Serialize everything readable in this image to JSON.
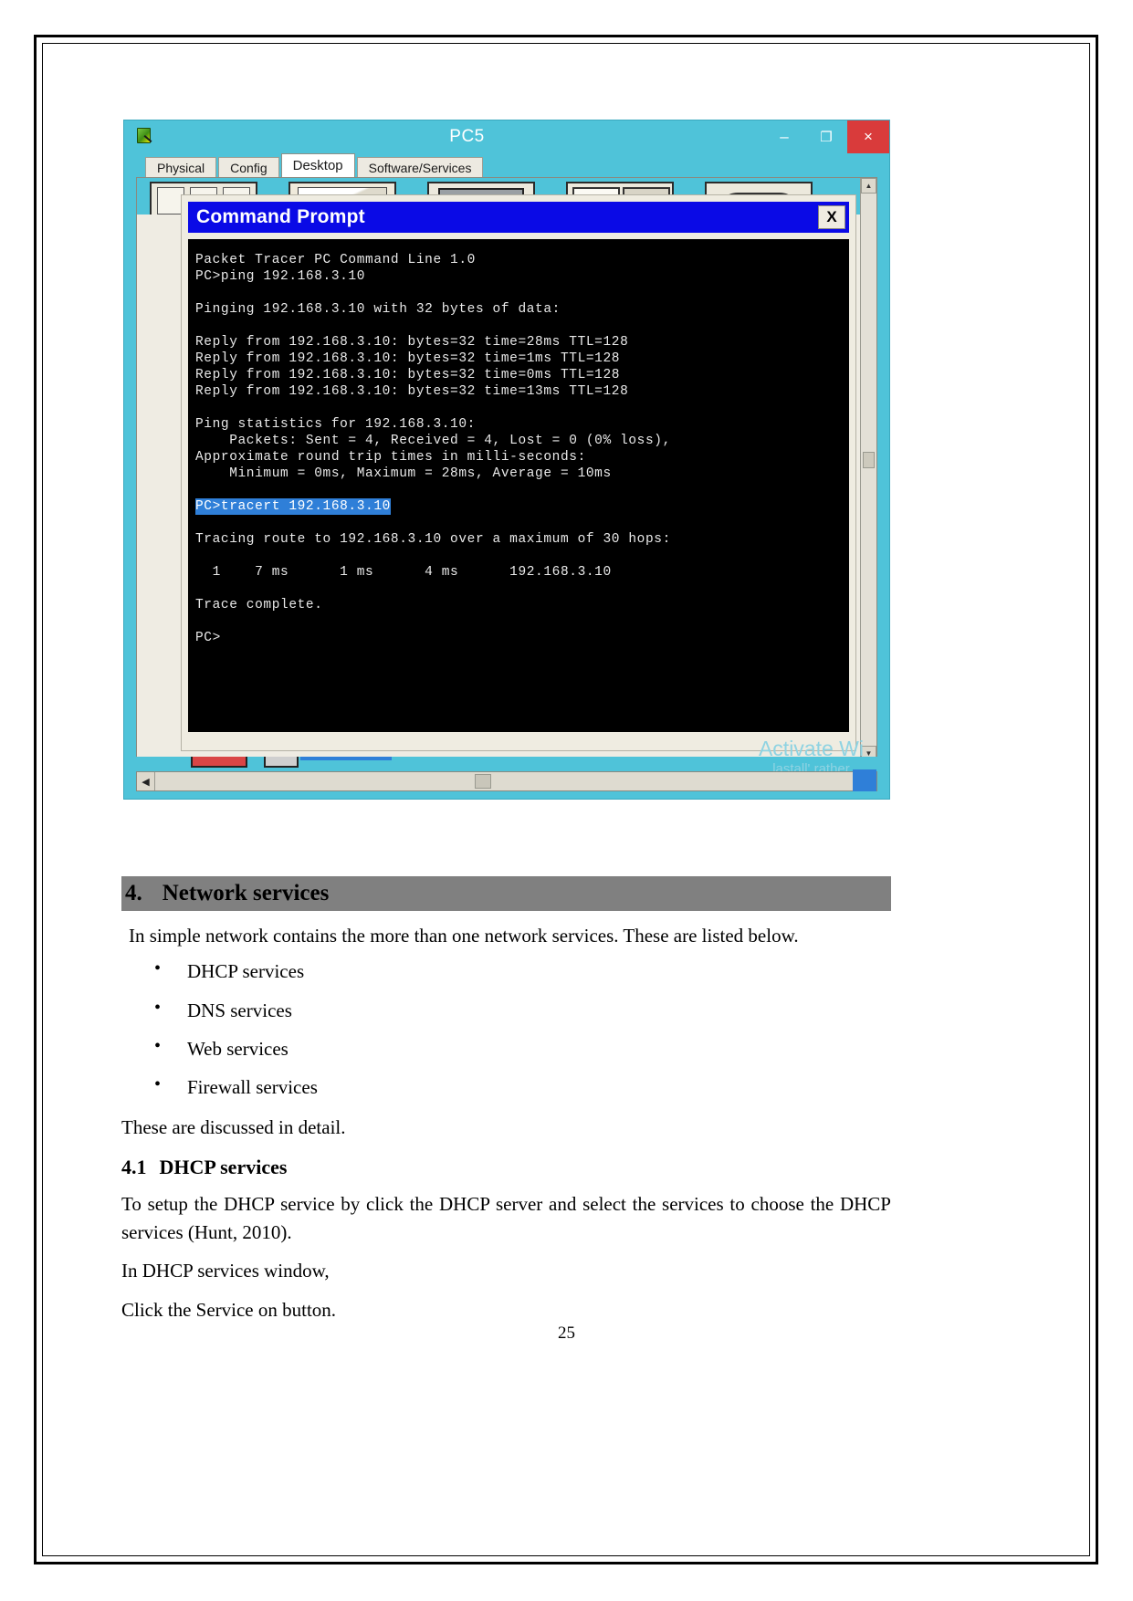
{
  "window": {
    "title": "PC5",
    "icon": "packet-tracer-icon",
    "controls": {
      "minimize": "–",
      "maximize": "❐",
      "close": "×"
    },
    "tabs": [
      {
        "label": "Physical",
        "active": false
      },
      {
        "label": "Config",
        "active": false
      },
      {
        "label": "Desktop",
        "active": true
      },
      {
        "label": "Software/Services",
        "active": false
      }
    ]
  },
  "command_prompt": {
    "title": "Command Prompt",
    "close_label": "X",
    "lines": [
      {
        "text": "Packet Tracer PC Command Line 1.0",
        "selected": false
      },
      {
        "text": "PC>ping 192.168.3.10",
        "selected": false
      },
      {
        "text": "",
        "selected": false
      },
      {
        "text": "Pinging 192.168.3.10 with 32 bytes of data:",
        "selected": false
      },
      {
        "text": "",
        "selected": false
      },
      {
        "text": "Reply from 192.168.3.10: bytes=32 time=28ms TTL=128",
        "selected": false
      },
      {
        "text": "Reply from 192.168.3.10: bytes=32 time=1ms TTL=128",
        "selected": false
      },
      {
        "text": "Reply from 192.168.3.10: bytes=32 time=0ms TTL=128",
        "selected": false
      },
      {
        "text": "Reply from 192.168.3.10: bytes=32 time=13ms TTL=128",
        "selected": false
      },
      {
        "text": "",
        "selected": false
      },
      {
        "text": "Ping statistics for 192.168.3.10:",
        "selected": false
      },
      {
        "text": "    Packets: Sent = 4, Received = 4, Lost = 0 (0% loss),",
        "selected": false
      },
      {
        "text": "Approximate round trip times in milli-seconds:",
        "selected": false
      },
      {
        "text": "    Minimum = 0ms, Maximum = 28ms, Average = 10ms",
        "selected": false
      },
      {
        "text": "",
        "selected": false
      },
      {
        "text": "PC>tracert 192.168.3.10",
        "selected": true
      },
      {
        "text": "",
        "selected": false
      },
      {
        "text": "Tracing route to 192.168.3.10 over a maximum of 30 hops: ",
        "selected": false
      },
      {
        "text": "",
        "selected": false
      },
      {
        "text": "  1    7 ms      1 ms      4 ms      192.168.3.10",
        "selected": false
      },
      {
        "text": "",
        "selected": false
      },
      {
        "text": "Trace complete.",
        "selected": false
      },
      {
        "text": "",
        "selected": false
      },
      {
        "text": "PC>",
        "selected": false
      }
    ]
  },
  "watermark": {
    "line1": "Activate Wi",
    "line2": "lastall' rather"
  },
  "document": {
    "section_number": "4.",
    "section_title": "Network services",
    "intro": "In simple network contains the more than one network services. These are listed below.",
    "bullets": [
      "DHCP services",
      "DNS services",
      "Web services",
      "Firewall services"
    ],
    "after_bullets": "These are discussed in detail.",
    "subsection_number": "4.1",
    "subsection_title": "DHCP services",
    "body_paragraph": "To setup the DHCP service by click the DHCP server and select the services to choose the DHCP services (Hunt, 2010).",
    "line_dhcp_window": "In DHCP services window,",
    "line_service_on": "Click the Service on button.",
    "page_number": "25"
  },
  "colors": {
    "pt_accent": "#4fc3d9",
    "cmd_titlebar": "#0a0ae6",
    "selection": "#2f7fd8",
    "heading_band": "#808080",
    "close_button": "#d93b3b"
  }
}
